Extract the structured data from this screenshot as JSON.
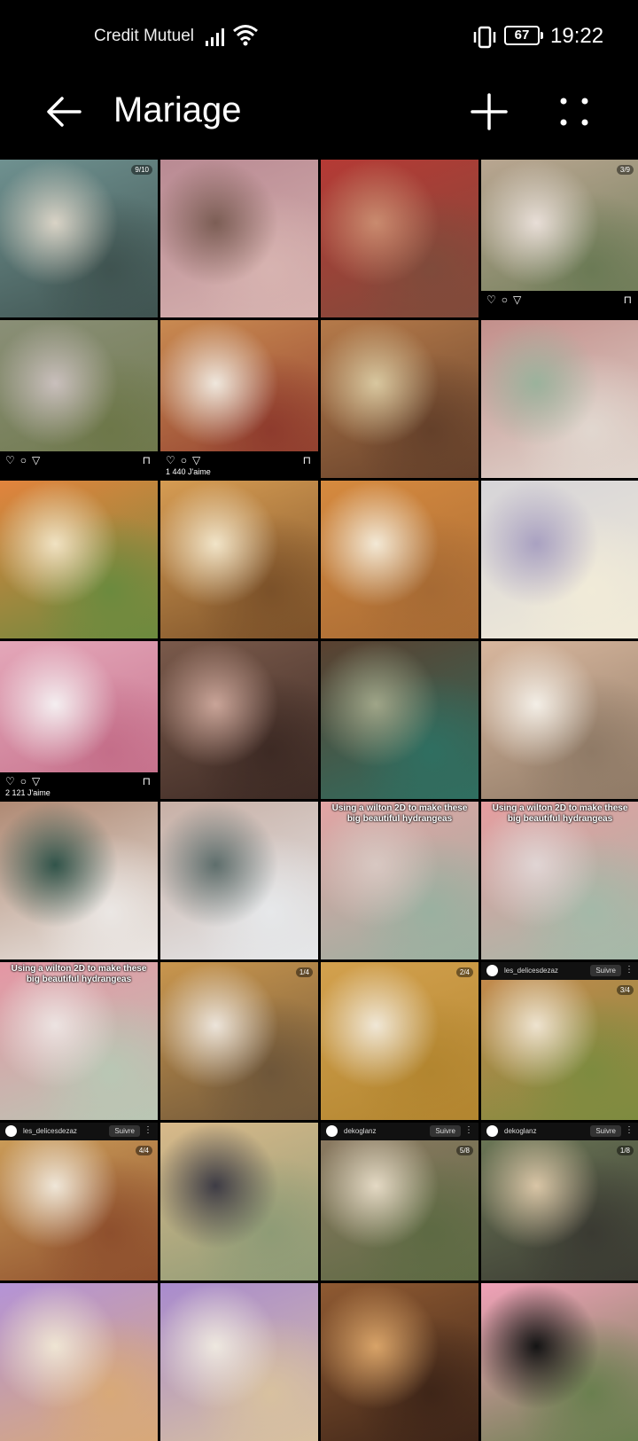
{
  "status_bar": {
    "carrier": "Credit Mutuel",
    "battery": "67",
    "time": "19:22"
  },
  "app_bar": {
    "title": "Mariage",
    "back_icon": "arrow-left-icon",
    "add_icon": "plus-icon",
    "more_icon": "more-grid-icon"
  },
  "grid": {
    "tiles": [
      {
        "subject": "man in teal suit",
        "colors": [
          "#6f9190",
          "#d9d3c6",
          "#3f5350"
        ],
        "count": "9/10"
      },
      {
        "subject": "man in pink suit",
        "colors": [
          "#b98a93",
          "#7c5e55",
          "#d7b3b0"
        ]
      },
      {
        "subject": "woman in red dress",
        "colors": [
          "#b53a35",
          "#c98b6f",
          "#7f4b3b"
        ]
      },
      {
        "subject": "wedding couple",
        "colors": [
          "#b9a691",
          "#e8ded7",
          "#6b7a55"
        ],
        "count": "3/9",
        "bottom_bar": true
      },
      {
        "subject": "man in grey suit",
        "colors": [
          "#8a8f77",
          "#c9bfbc",
          "#6d7749"
        ],
        "bottom_bar": true
      },
      {
        "subject": "charcuterie platters",
        "colors": [
          "#c98a51",
          "#efe7dd",
          "#8e3b2d"
        ],
        "bottom_bar": true,
        "likes": "1 440 J'aime"
      },
      {
        "subject": "appetizer boards",
        "colors": [
          "#b57a4a",
          "#d8c79f",
          "#64402a"
        ]
      },
      {
        "subject": "flower cupcakes",
        "colors": [
          "#c38f8b",
          "#9bb29c",
          "#e1d7cf"
        ]
      },
      {
        "subject": "bruschetta and sandwiches",
        "colors": [
          "#e2843d",
          "#f0e2c2",
          "#6b8a3e"
        ]
      },
      {
        "subject": "mini burgers",
        "colors": [
          "#d69c53",
          "#f1e4c8",
          "#7b5129"
        ]
      },
      {
        "subject": "sandwich box",
        "colors": [
          "#d68a3f",
          "#f3e9d6",
          "#a66a34"
        ]
      },
      {
        "subject": "daisy cupcakes",
        "colors": [
          "#d6d4d8",
          "#a9a1c1",
          "#f1ebd8"
        ]
      },
      {
        "subject": "pink cupcakes",
        "colors": [
          "#e4a7b9",
          "#f4eef0",
          "#c46e89"
        ],
        "bottom_bar": true,
        "likes": "2 121 J'aime"
      },
      {
        "subject": "dessert table",
        "colors": [
          "#7a5a4b",
          "#c9a498",
          "#3d2a24"
        ]
      },
      {
        "subject": "flower hair crown",
        "colors": [
          "#5a4130",
          "#9fa588",
          "#2f6f61"
        ]
      },
      {
        "subject": "bride with floral crown",
        "colors": [
          "#d8b79e",
          "#f3eee6",
          "#8f7a66"
        ]
      },
      {
        "subject": "green nails",
        "colors": [
          "#b08a74",
          "#31544a",
          "#ebe7e4"
        ]
      },
      {
        "subject": "grey nails",
        "colors": [
          "#c8b0a6",
          "#5e6e6c",
          "#e6e8ea"
        ]
      },
      {
        "subject": "hydrangea cupcake",
        "colors": [
          "#e3a4a4",
          "#d8c8c2",
          "#9ab0a0"
        ],
        "caption": "Using a wilton 2D to make these big beautiful hydrangeas"
      },
      {
        "subject": "hydrangea piping",
        "colors": [
          "#e69d9f",
          "#e0d5d4",
          "#a4b9a8"
        ],
        "caption": "Using a wilton 2D to make these big beautiful hydrangeas"
      },
      {
        "subject": "hydrangea cupcake 2",
        "colors": [
          "#e596a4",
          "#ece3e1",
          "#b9c7b4"
        ],
        "caption": "Using a wilton 2D to make these big beautiful hydrangeas"
      },
      {
        "subject": "sandwich platter",
        "colors": [
          "#c9964e",
          "#ece4da",
          "#6e5639"
        ],
        "count": "1/4"
      },
      {
        "subject": "mini sandwiches box",
        "colors": [
          "#d3a14e",
          "#f0e7d6",
          "#b2852f"
        ],
        "count": "2/4"
      },
      {
        "subject": "wraps and sandwiches",
        "colors": [
          "#c98a4d",
          "#eee3cf",
          "#7d8b3f"
        ],
        "header_user": "les_delicesdezaz",
        "header_follow": "Suivre",
        "count": "3/4"
      },
      {
        "subject": "sandwich tray",
        "colors": [
          "#cfa15b",
          "#efe6d8",
          "#8e4f2d"
        ],
        "header_user": "les_delicesdezaz",
        "header_follow": "Suivre",
        "count": "4/4"
      },
      {
        "subject": "cupcake decorating",
        "colors": [
          "#d8b98a",
          "#3e3c45",
          "#8e9b76"
        ]
      },
      {
        "subject": "candle centerpiece",
        "colors": [
          "#8e7a63",
          "#e4d9c4",
          "#5d6a43"
        ],
        "header_user": "dekoglanz",
        "header_follow": "Suivre",
        "count": "5/8"
      },
      {
        "subject": "candle arrangement",
        "colors": [
          "#6e7a58",
          "#d9c5a6",
          "#3a3a32"
        ],
        "header_user": "dekoglanz",
        "header_follow": "Suivre",
        "count": "1/8"
      },
      {
        "subject": "purple flower cupcakes",
        "colors": [
          "#b493d7",
          "#efe5d3",
          "#d8a978"
        ]
      },
      {
        "subject": "lavender cupcakes",
        "colors": [
          "#a98bce",
          "#eee8df",
          "#d8c19f"
        ]
      },
      {
        "subject": "grazing table",
        "colors": [
          "#8f5a32",
          "#d8a368",
          "#3e2518"
        ]
      },
      {
        "subject": "pink rose",
        "colors": [
          "#f0a1b8",
          "#141414",
          "#6a7f4f"
        ]
      }
    ]
  }
}
